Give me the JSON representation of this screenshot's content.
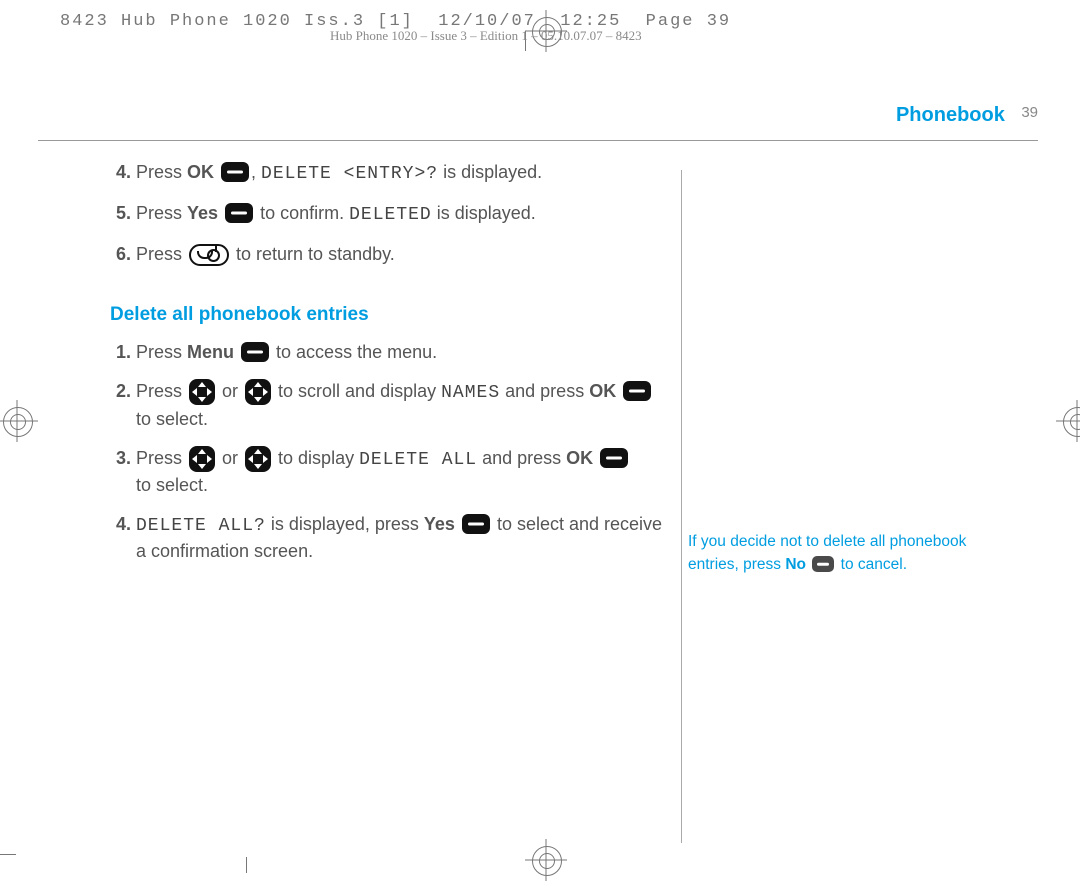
{
  "slug": "8423 Hub Phone 1020 Iss.3 [1]  12/10/07  12:25  Page 39",
  "subslug": "Hub Phone 1020 – Issue 3 – Edition 1 – 05.10.07.07 – 8423",
  "header": {
    "title": "Phonebook",
    "page": "39"
  },
  "cont": {
    "s4_a": "Press ",
    "s4_ok": "OK",
    "s4_b": ", ",
    "s4_code": "DELETE <ENTRY>?",
    "s4_c": " is displayed.",
    "s5_a": "Press ",
    "s5_yes": "Yes",
    "s5_b": " to confirm. ",
    "s5_code": "DELETED",
    "s5_c": " is displayed.",
    "s6_a": "Press ",
    "s6_b": " to return to standby."
  },
  "subhead": "Delete all phonebook entries",
  "del": {
    "s1_a": "Press ",
    "s1_menu": "Menu",
    "s1_b": " to access the menu.",
    "s2_a": "Press ",
    "s2_b": " or ",
    "s2_c": " to scroll and display ",
    "s2_code": "NAMES",
    "s2_d": " and press ",
    "s2_ok": "OK",
    "s2_e": " to select.",
    "s3_a": "Press ",
    "s3_b": " or ",
    "s3_c": " to display ",
    "s3_code": "DELETE ALL",
    "s3_d": " and press ",
    "s3_ok": "OK",
    "s3_e": " to select.",
    "s4_code": "DELETE ALL?",
    "s4_a": " is displayed, press ",
    "s4_yes": "Yes",
    "s4_b": " to select and receive a confirmation screen."
  },
  "sidenote": {
    "a": "If you decide not to delete all phonebook entries, press ",
    "no": "No",
    "b": " to cancel."
  }
}
